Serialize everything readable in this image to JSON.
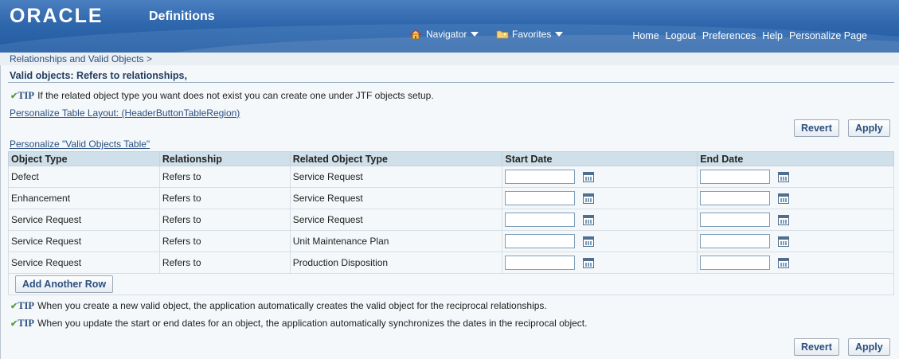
{
  "header": {
    "logo": "ORACLE",
    "app_title": "Definitions",
    "navigator_label": "Navigator",
    "favorites_label": "Favorites",
    "global_links": [
      "Home",
      "Logout",
      "Preferences",
      "Help",
      "Personalize Page"
    ]
  },
  "breadcrumb": "Relationships and Valid Objects  >",
  "page_title": "Valid objects: Refers to relationships,",
  "tips": {
    "label": "TIP",
    "top": "If the related object type you want does not exist you can create one under JTF objects setup.",
    "bottom1": "When you create a new valid object, the application automatically creates the valid object for the reciprocal relationships.",
    "bottom2": "When you update the start or end dates for an object, the application automatically synchronizes the dates in the reciprocal object."
  },
  "links": {
    "personalize_layout": "Personalize Table Layout: (HeaderButtonTableRegion)",
    "personalize_table": "Personalize \"Valid Objects Table\""
  },
  "buttons": {
    "revert": "Revert",
    "apply": "Apply",
    "add_row": "Add Another Row"
  },
  "table": {
    "columns": [
      "Object Type",
      "Relationship",
      "Related Object Type",
      "Start Date",
      "End Date"
    ],
    "rows": [
      {
        "object_type": "Defect",
        "relationship": "Refers to",
        "related": "Service Request",
        "start": "",
        "end": ""
      },
      {
        "object_type": "Enhancement",
        "relationship": "Refers to",
        "related": "Service Request",
        "start": "",
        "end": ""
      },
      {
        "object_type": "Service Request",
        "relationship": "Refers to",
        "related": "Service Request",
        "start": "",
        "end": ""
      },
      {
        "object_type": "Service Request",
        "relationship": "Refers to",
        "related": "Unit Maintenance Plan",
        "start": "",
        "end": ""
      },
      {
        "object_type": "Service Request",
        "relationship": "Refers to",
        "related": "Production Disposition",
        "start": "",
        "end": ""
      }
    ]
  },
  "colors": {
    "header_blue": "#2f67ad",
    "link": "#2b4f80",
    "table_header": "#cfe0ea",
    "tip_check": "#5a9d3a"
  }
}
